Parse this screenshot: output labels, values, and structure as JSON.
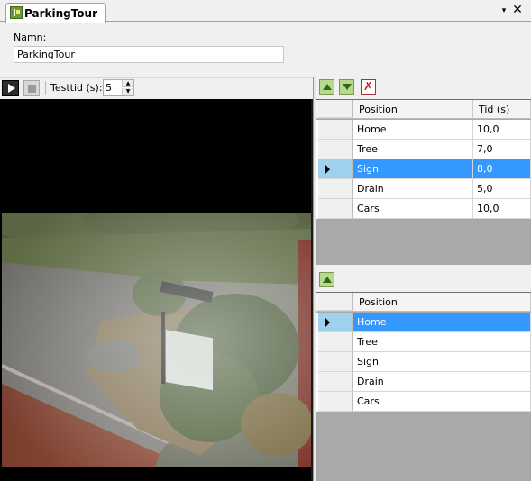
{
  "tab": {
    "title": "ParkingTour",
    "dropdown_glyph": "▾",
    "close_glyph": "✕"
  },
  "form": {
    "name_label": "Namn:",
    "name_value": "ParkingTour"
  },
  "video_toolbar": {
    "testtid_label": "Testtid (s):",
    "testtid_value": "5"
  },
  "positions_grid": {
    "headers": {
      "position": "Position",
      "tid": "Tid (s)"
    },
    "rows": [
      {
        "position": "Home",
        "tid": "10,0"
      },
      {
        "position": "Tree",
        "tid": "7,0"
      },
      {
        "position": "Sign",
        "tid": "8,0"
      },
      {
        "position": "Drain",
        "tid": "5,0"
      },
      {
        "position": "Cars",
        "tid": "10,0"
      }
    ],
    "selected_index": 2
  },
  "available_grid": {
    "headers": {
      "position": "Position"
    },
    "rows": [
      {
        "position": "Home"
      },
      {
        "position": "Tree"
      },
      {
        "position": "Sign"
      },
      {
        "position": "Drain"
      },
      {
        "position": "Cars"
      }
    ],
    "selected_index": 0
  },
  "icons": {
    "tab": "camera-tour-icon",
    "play": "play-icon",
    "stop": "stop-icon",
    "move_up": "arrow-up-icon",
    "move_down": "arrow-down-icon",
    "delete": "delete-icon",
    "add": "arrow-up-icon"
  },
  "colors": {
    "selection": "#3399ff",
    "row_header_selected": "#9fd0ee",
    "grid_background": "#a9a9a9",
    "accent_green": "#2e6a14",
    "delete_red": "#d01818"
  }
}
